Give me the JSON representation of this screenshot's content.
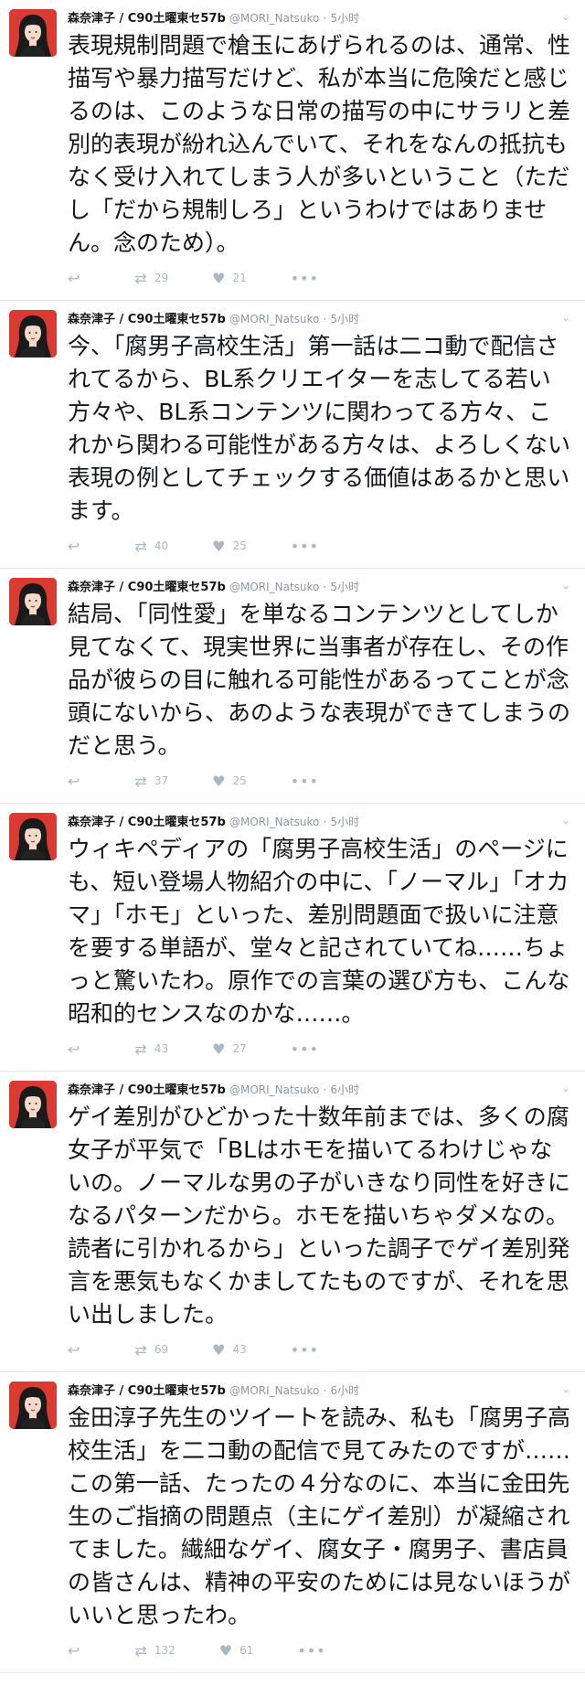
{
  "tweets": [
    {
      "name": "森奈津子 / C90土曜東セ57b",
      "handle": "@MORI_Natsuko",
      "time": "5小时",
      "text": "表現規制問題で槍玉にあげられるのは、通常、性描写や暴力描写だけど、私が本当に危険だと感じるのは、このような日常の描写の中にサラリと差別的表現が紛れ込んでいて、それをなんの抵抗もなく受け入れてしまう人が多いということ（ただし「だから規制しろ」というわけではありません。念のため）。",
      "retweets": "29",
      "likes": "21"
    },
    {
      "name": "森奈津子 / C90土曜東セ57b",
      "handle": "@MORI_Natsuko",
      "time": "5小时",
      "text": "今、「腐男子高校生活」第一話は二コ動で配信されてるから、BL系クリエイターを志してる若い方々や、BL系コンテンツに関わってる方々、これから関わる可能性がある方々は、よろしくない表現の例としてチェックする価値はあるかと思います。",
      "retweets": "40",
      "likes": "25"
    },
    {
      "name": "森奈津子 / C90土曜東セ57b",
      "handle": "@MORI_Natsuko",
      "time": "5小时",
      "text": "結局、「同性愛」を単なるコンテンツとしてしか見てなくて、現実世界に当事者が存在し、その作品が彼らの目に触れる可能性があるってことが念頭にないから、あのような表現ができてしまうのだと思う。",
      "retweets": "37",
      "likes": "25"
    },
    {
      "name": "森奈津子 / C90土曜東セ57b",
      "handle": "@MORI_Natsuko",
      "time": "5小时",
      "text": "ウィキペディアの「腐男子高校生活」のページにも、短い登場人物紹介の中に、「ノーマル」「オカマ」「ホモ」といった、差別問題面で扱いに注意を要する単語が、堂々と記されていてね……ちょっと驚いたわ。原作での言葉の選び方も、こんな昭和的センスなのかな……。",
      "retweets": "43",
      "likes": "27"
    },
    {
      "name": "森奈津子 / C90土曜東セ57b",
      "handle": "@MORI_Natsuko",
      "time": "6小时",
      "text": "ゲイ差別がひどかった十数年前までは、多くの腐女子が平気で「BLはホモを描いてるわけじゃないの。ノーマルな男の子がいきなり同性を好きになるパターンだから。ホモを描いちゃダメなの。読者に引かれるから」といった調子でゲイ差別発言を悪気もなくかましてたものですが、それを思い出しました。",
      "retweets": "69",
      "likes": "43"
    },
    {
      "name": "森奈津子 / C90土曜東セ57b",
      "handle": "@MORI_Natsuko",
      "time": "6小时",
      "text": "金田淳子先生のツイートを読み、私も「腐男子高校生活」を二コ動の配信で見てみたのですが……この第一話、たったの４分なのに、本当に金田先生のご指摘の問題点（主にゲイ差別）が凝縮されてました。繊細なゲイ、腐女子・腐男子、書店員の皆さんは、精神の平安のためには見ないほうがいいと思ったわ。",
      "retweets": "132",
      "likes": "61"
    }
  ],
  "icons": {
    "reply": "reply-arrow-icon",
    "retweet": "retweet-icon",
    "like": "heart-icon",
    "more": "more-dots-icon",
    "caret": "chevron-down-icon"
  },
  "colors": {
    "avatar_bg": "#d93a32",
    "icon_gray": "#aab8c2",
    "meta_gray": "#8899a6",
    "divider": "#e1e8ed"
  }
}
